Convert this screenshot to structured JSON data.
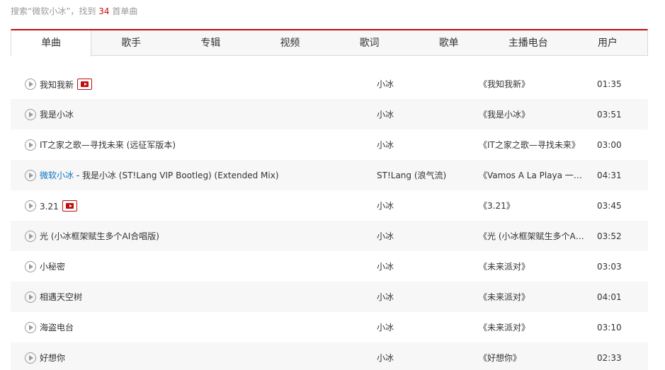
{
  "summary": {
    "prefix": "搜索“微软小冰”，找到",
    "count": "34",
    "suffix": "首单曲"
  },
  "tabs": [
    {
      "label": "单曲"
    },
    {
      "label": "歌手"
    },
    {
      "label": "专辑"
    },
    {
      "label": "视频"
    },
    {
      "label": "歌词"
    },
    {
      "label": "歌单"
    },
    {
      "label": "主播电台"
    },
    {
      "label": "用户"
    }
  ],
  "songs": [
    {
      "title": "我知我新",
      "highlight": "",
      "artist": "小冰",
      "album": "《我知我新》",
      "duration": "01:35",
      "mv": true
    },
    {
      "title": "我是小冰",
      "highlight": "",
      "artist": "小冰",
      "album": "《我是小冰》",
      "duration": "03:51",
      "mv": false
    },
    {
      "title": "IT之家之歌—寻找未来 (远征军版本)",
      "highlight": "",
      "artist": "小冰",
      "album": "《IT之家之歌—寻找未来》",
      "duration": "03:00",
      "mv": false
    },
    {
      "title": " - 我是小冰 (ST!Lang VIP Bootleg) (Extended Mix)",
      "highlight": "微软小冰",
      "artist": "ST!Lang (浪气流)",
      "album": "《Vamos A La Playa 一起…",
      "duration": "04:31",
      "mv": false
    },
    {
      "title": "3.21",
      "highlight": "",
      "artist": "小冰",
      "album": "《3.21》",
      "duration": "03:45",
      "mv": true
    },
    {
      "title": "光 (小冰框架赋生多个AI合唱版)",
      "highlight": "",
      "artist": "小冰",
      "album": "《光 (小冰框架赋生多个AI…",
      "duration": "03:52",
      "mv": false
    },
    {
      "title": "小秘密",
      "highlight": "",
      "artist": "小冰",
      "album": "《未来派对》",
      "duration": "03:03",
      "mv": false
    },
    {
      "title": "相遇天空树",
      "highlight": "",
      "artist": "小冰",
      "album": "《未来派对》",
      "duration": "04:01",
      "mv": false
    },
    {
      "title": "海盗电台",
      "highlight": "",
      "artist": "小冰",
      "album": "《未来派对》",
      "duration": "03:10",
      "mv": false
    },
    {
      "title": "好想你",
      "highlight": "",
      "artist": "小冰",
      "album": "《好想你》",
      "duration": "02:33",
      "mv": false
    }
  ]
}
